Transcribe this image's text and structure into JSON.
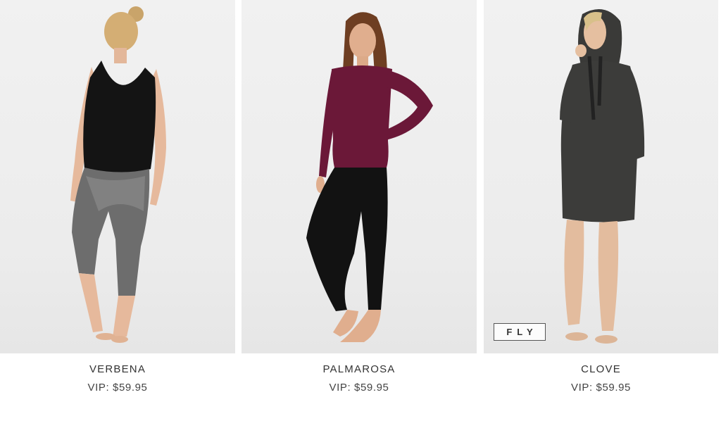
{
  "products": [
    {
      "name": "VERBENA",
      "price": "VIP: $59.95"
    },
    {
      "name": "PALMAROSA",
      "price": "VIP: $59.95"
    },
    {
      "name": "CLOVE",
      "price": "VIP: $59.95",
      "badge": "FLY"
    }
  ],
  "colors": {
    "background": "#ffffff",
    "photo_background": "#efefef",
    "text": "#333333",
    "verbena_top": "#141414",
    "palmarosa_top": "#6b1838",
    "clove_dress": "#3c3c3a"
  }
}
